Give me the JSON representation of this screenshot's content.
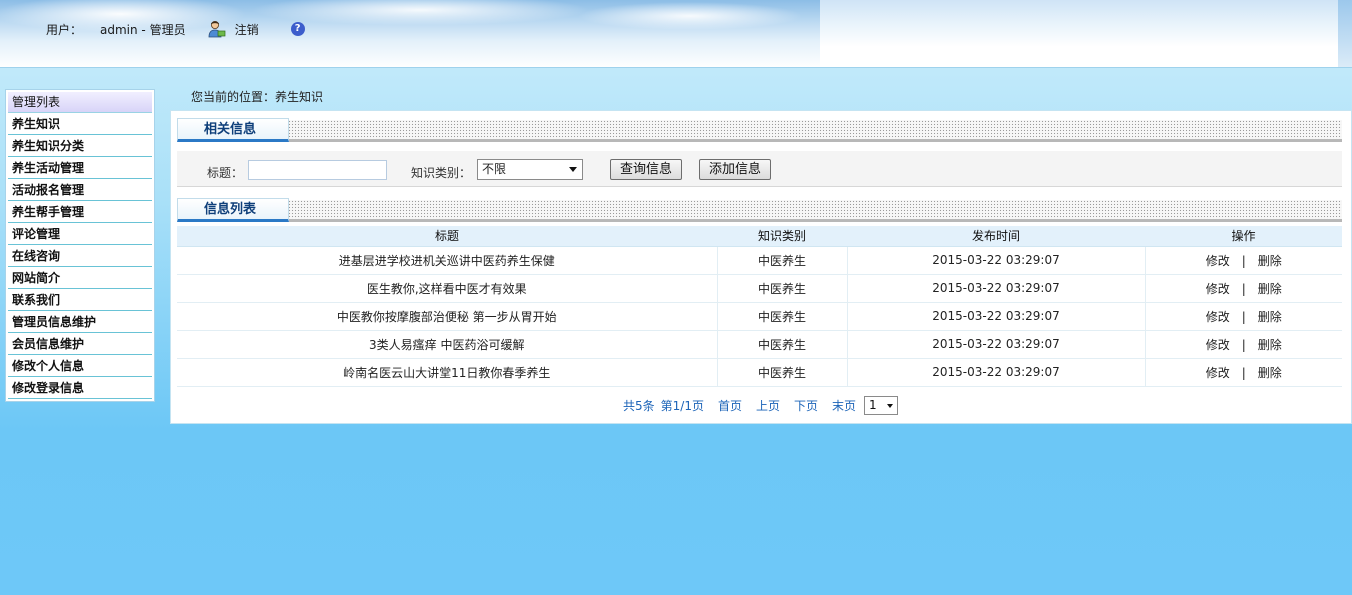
{
  "header": {
    "user_label": "用户：",
    "user_name": "admin - 管理员",
    "logout_label": "注销",
    "help_glyph": "?"
  },
  "sidebar": {
    "title": "管理列表",
    "items": [
      {
        "label": "养生知识"
      },
      {
        "label": "养生知识分类"
      },
      {
        "label": "养生活动管理"
      },
      {
        "label": "活动报名管理"
      },
      {
        "label": "养生帮手管理"
      },
      {
        "label": "评论管理"
      },
      {
        "label": "在线咨询"
      },
      {
        "label": "网站简介"
      },
      {
        "label": "联系我们"
      },
      {
        "label": "管理员信息维护"
      },
      {
        "label": "会员信息维护"
      },
      {
        "label": "修改个人信息"
      },
      {
        "label": "修改登录信息"
      }
    ]
  },
  "breadcrumb": "您当前的位置：养生知识",
  "search": {
    "section_title": "相关信息",
    "title_label": "标题：",
    "title_value": "",
    "category_label": "知识类别：",
    "category_value": "不限",
    "query_button": "查询信息",
    "add_button": "添加信息"
  },
  "list": {
    "section_title": "信息列表",
    "columns": [
      "标题",
      "知识类别",
      "发布时间",
      "操作"
    ],
    "rows": [
      {
        "title": "进基层进学校进机关巡讲中医药养生保健",
        "category": "中医养生",
        "time": "2015-03-22 03:29:07",
        "edit": "修改",
        "sep": "|",
        "del": "删除"
      },
      {
        "title": "医生教你,这样看中医才有效果",
        "category": "中医养生",
        "time": "2015-03-22 03:29:07",
        "edit": "修改",
        "sep": "|",
        "del": "删除"
      },
      {
        "title": "中医教你按摩腹部治便秘 第一步从胃开始",
        "category": "中医养生",
        "time": "2015-03-22 03:29:07",
        "edit": "修改",
        "sep": "|",
        "del": "删除"
      },
      {
        "title": "3类人易瘙痒 中医药浴可缓解",
        "category": "中医养生",
        "time": "2015-03-22 03:29:07",
        "edit": "修改",
        "sep": "|",
        "del": "删除"
      },
      {
        "title": "岭南名医云山大讲堂11日教你春季养生",
        "category": "中医养生",
        "time": "2015-03-22 03:29:07",
        "edit": "修改",
        "sep": "|",
        "del": "删除"
      }
    ]
  },
  "pager": {
    "total": "共5条",
    "page_info": "第1/1页",
    "first": "首页",
    "prev": "上页",
    "next": "下页",
    "last": "末页",
    "page_select": "1"
  },
  "colors": {
    "link_blue": "#1c64b8",
    "tab_accent": "#2b79c6",
    "background": "#6ec8f8"
  }
}
